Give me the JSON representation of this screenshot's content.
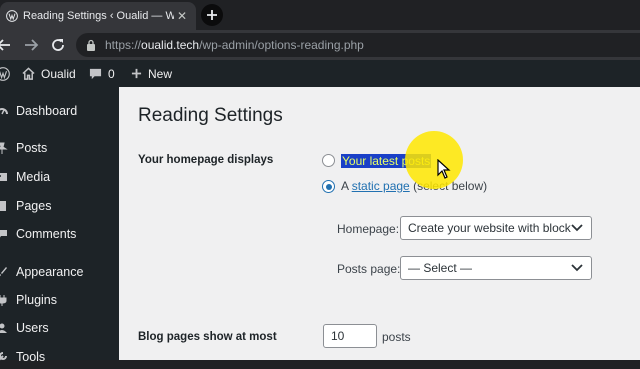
{
  "browser": {
    "tab_title": "Reading Settings ‹ Oualid — Wo",
    "url_host": "oualid.tech",
    "url_scheme": "https://",
    "url_path": "/wp-admin/options-reading.php"
  },
  "adminbar": {
    "site_name": "Oualid",
    "comments_count": "0",
    "new_label": "New"
  },
  "sidebar": {
    "items": [
      {
        "label": "Dashboard",
        "icon": "dashboard-icon"
      },
      {
        "label": "Posts",
        "icon": "pin-icon"
      },
      {
        "label": "Media",
        "icon": "media-icon"
      },
      {
        "label": "Pages",
        "icon": "page-icon"
      },
      {
        "label": "Comments",
        "icon": "comment-icon"
      },
      {
        "label": "Appearance",
        "icon": "brush-icon"
      },
      {
        "label": "Plugins",
        "icon": "plug-icon"
      },
      {
        "label": "Users",
        "icon": "user-icon"
      },
      {
        "label": "Tools",
        "icon": "wrench-icon"
      }
    ]
  },
  "main": {
    "title": "Reading Settings",
    "homepage_displays_label": "Your homepage displays",
    "option_latest_posts": "Your latest posts",
    "option_static_prefix": "A",
    "option_static_link": "static page",
    "option_static_suffix": "(select below)",
    "homepage_label": "Homepage:",
    "homepage_value": "Create your website with blocks",
    "posts_page_label": "Posts page:",
    "posts_page_value": "— Select —",
    "blog_pages_label": "Blog pages show at most",
    "blog_pages_value": "10",
    "blog_pages_unit": "posts"
  },
  "colors": {
    "wp_dark": "#1d2327",
    "wp_blue": "#2271b1",
    "content_bg": "#f0f0f1",
    "selection_bg": "#1a40c8",
    "selection_text": "#e8ff66",
    "cursor_highlight": "#ffe800"
  }
}
